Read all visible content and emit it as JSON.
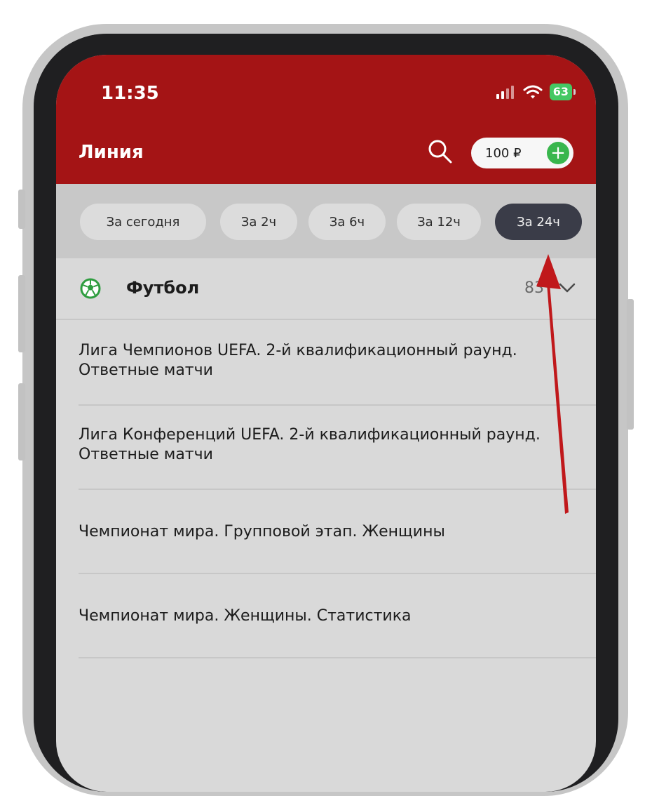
{
  "status_bar": {
    "time": "11:35",
    "battery": "63"
  },
  "header": {
    "title": "Линия",
    "balance": "100 ₽",
    "balance_add": "+"
  },
  "filters": [
    {
      "label": "За сегодня",
      "active": false
    },
    {
      "label": "За 2ч",
      "active": false
    },
    {
      "label": "За 6ч",
      "active": false
    },
    {
      "label": "За 12ч",
      "active": false
    },
    {
      "label": "За 24ч",
      "active": true
    }
  ],
  "sport": {
    "name": "Футбол",
    "count": "83"
  },
  "leagues": [
    "Лига Чемпионов UEFA. 2-й квалификационный раунд. Ответные матчи",
    "Лига Конференций UEFA. 2-й квалификационный раунд. Ответные матчи",
    "Чемпионат мира. Групповой этап. Женщины",
    "Чемпионат мира. Женщины. Статистика"
  ],
  "colors": {
    "header_red": "#a41415",
    "active_chip": "#3a3c48",
    "plus_green": "#39b64d",
    "battery_green": "#44c864",
    "arrow_red": "#c0181b"
  },
  "icons": {
    "search": "search-icon",
    "add": "plus-icon",
    "sport": "soccer-ball-icon",
    "expand": "chevron-down-icon"
  }
}
